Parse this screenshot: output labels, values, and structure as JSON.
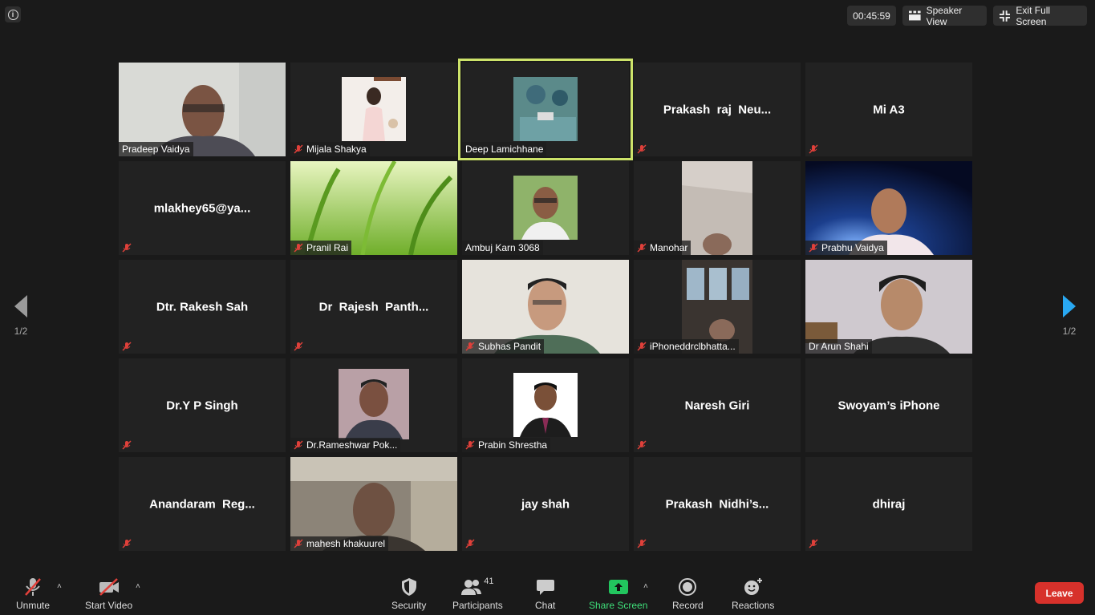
{
  "top": {
    "timer": "00:45:59",
    "speaker_view": "Speaker View",
    "exit_full_screen": "Exit Full Screen"
  },
  "nav": {
    "left_page": "1/2",
    "right_page": "1/2"
  },
  "tiles": [
    {
      "label": "Pradeep Vaidya"
    },
    {
      "label": "Mijala Shakya"
    },
    {
      "label": "Deep Lamichhane"
    },
    {
      "title": "Prakash  raj  Neu..."
    },
    {
      "title": "Mi A3"
    },
    {
      "title": "mlakhey65@ya..."
    },
    {
      "label": "Pranil Rai"
    },
    {
      "label": "Ambuj Karn 3068"
    },
    {
      "label": "Manohar"
    },
    {
      "label": "Prabhu Vaidya"
    },
    {
      "title": "Dtr. Rakesh Sah"
    },
    {
      "title": "Dr  Rajesh  Panth..."
    },
    {
      "label": "Subhas Pandit"
    },
    {
      "label": "iPhoneddrclbhatta..."
    },
    {
      "label": "Dr Arun Shahi"
    },
    {
      "title": "Dr.Y P Singh"
    },
    {
      "label": "Dr.Rameshwar Pok..."
    },
    {
      "label": "Prabin Shrestha"
    },
    {
      "title": "Naresh Giri"
    },
    {
      "title": "Swoyam’s iPhone"
    },
    {
      "title": "Anandaram  Reg..."
    },
    {
      "label": "mahesh khakuurel"
    },
    {
      "title": "jay shah"
    },
    {
      "title": "Prakash  Nidhi’s..."
    },
    {
      "title": "dhiraj"
    }
  ],
  "toolbar": {
    "unmute": "Unmute",
    "start_video": "Start Video",
    "security": "Security",
    "participants": "Participants",
    "participant_count": "41",
    "chat": "Chat",
    "share_screen": "Share Screen",
    "record": "Record",
    "reactions": "Reactions",
    "leave": "Leave"
  },
  "colors": {
    "active_speaker": "#cde36a",
    "share_green": "#3fe07a",
    "leave_red": "#d7312b",
    "muted_red": "#e0403a"
  }
}
